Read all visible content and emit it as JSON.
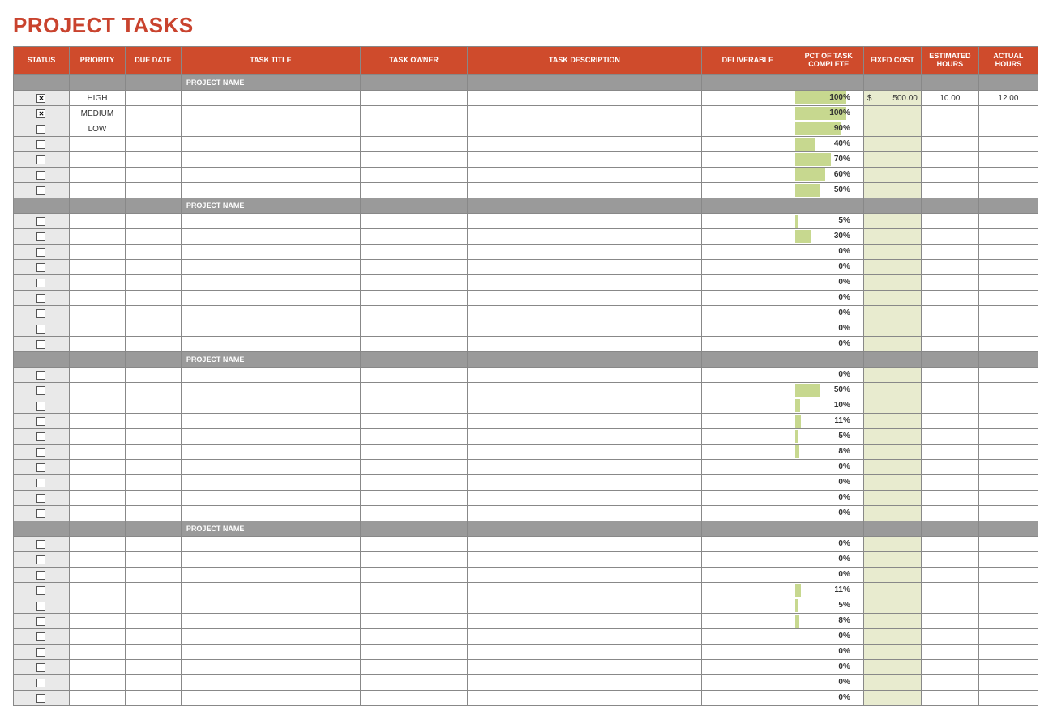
{
  "title": "PROJECT TASKS",
  "columns": {
    "status": "STATUS",
    "priority": "PRIORITY",
    "due_date": "DUE DATE",
    "task_title": "TASK TITLE",
    "task_owner": "TASK OWNER",
    "task_description": "TASK DESCRIPTION",
    "deliverable": "DELIVERABLE",
    "pct_complete": "PCT OF TASK COMPLETE",
    "fixed_cost": "FIXED COST",
    "est_hours": "ESTIMATED HOURS",
    "act_hours": "ACTUAL HOURS"
  },
  "section_label": "PROJECT NAME",
  "sections": [
    {
      "rows": [
        {
          "checked": true,
          "priority": "HIGH",
          "pct": 100,
          "cost_sym": "$",
          "cost_val": "500.00",
          "est": "10.00",
          "act": "12.00"
        },
        {
          "checked": true,
          "priority": "MEDIUM",
          "pct": 100
        },
        {
          "checked": false,
          "priority": "LOW",
          "pct": 90
        },
        {
          "checked": false,
          "pct": 40
        },
        {
          "checked": false,
          "pct": 70
        },
        {
          "checked": false,
          "pct": 60
        },
        {
          "checked": false,
          "pct": 50
        }
      ]
    },
    {
      "rows": [
        {
          "checked": false,
          "pct": 5
        },
        {
          "checked": false,
          "pct": 30
        },
        {
          "checked": false,
          "pct": 0
        },
        {
          "checked": false,
          "pct": 0
        },
        {
          "checked": false,
          "pct": 0
        },
        {
          "checked": false,
          "pct": 0
        },
        {
          "checked": false,
          "pct": 0
        },
        {
          "checked": false,
          "pct": 0
        },
        {
          "checked": false,
          "pct": 0
        }
      ]
    },
    {
      "rows": [
        {
          "checked": false,
          "pct": 0
        },
        {
          "checked": false,
          "pct": 50
        },
        {
          "checked": false,
          "pct": 10
        },
        {
          "checked": false,
          "pct": 11
        },
        {
          "checked": false,
          "pct": 5
        },
        {
          "checked": false,
          "pct": 8
        },
        {
          "checked": false,
          "pct": 0
        },
        {
          "checked": false,
          "pct": 0
        },
        {
          "checked": false,
          "pct": 0
        },
        {
          "checked": false,
          "pct": 0
        }
      ]
    },
    {
      "rows": [
        {
          "checked": false,
          "pct": 0
        },
        {
          "checked": false,
          "pct": 0
        },
        {
          "checked": false,
          "pct": 0
        },
        {
          "checked": false,
          "pct": 11
        },
        {
          "checked": false,
          "pct": 5
        },
        {
          "checked": false,
          "pct": 8
        },
        {
          "checked": false,
          "pct": 0
        },
        {
          "checked": false,
          "pct": 0
        },
        {
          "checked": false,
          "pct": 0
        },
        {
          "checked": false,
          "pct": 0
        },
        {
          "checked": false,
          "pct": 0
        }
      ]
    }
  ]
}
